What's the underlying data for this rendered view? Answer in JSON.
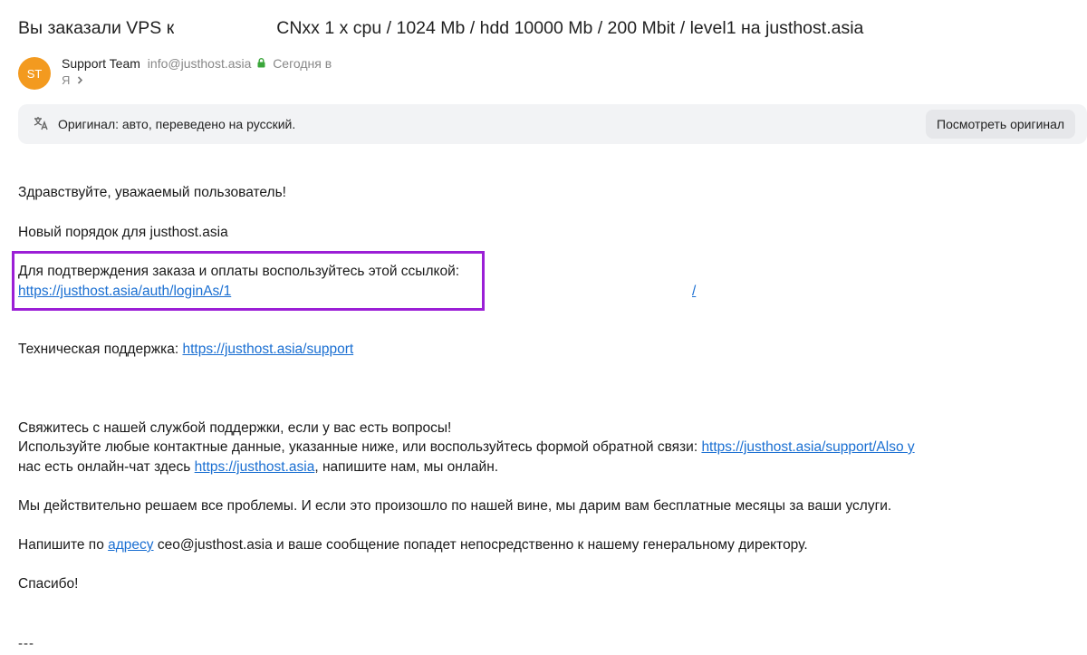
{
  "subject": {
    "start": "Вы заказали VPS к",
    "end": "CNxx 1 x cpu / 1024 Mb / hdd 10000 Mb / 200 Mbit / level1 на justhost.asia"
  },
  "sender": {
    "avatar_initials": "ST",
    "name": "Support Team",
    "email": "info@justhost.asia",
    "date": "Сегодня в",
    "recipient": "Я"
  },
  "translate_bar": {
    "text": "Оригинал: авто, переведено на русский.",
    "button_label": "Посмотреть оригинал"
  },
  "body": {
    "greeting": "Здравствуйте, уважаемый пользователь!",
    "new_order": "Новый порядок для justhost.asia",
    "confirm_text": "Для подтверждения заказа и оплаты воспользуйтесь этой ссылкой:",
    "confirm_link": "https://justhost.asia/auth/loginAs/1",
    "confirm_link_tail": "/",
    "support_label": "Техническая поддержка:",
    "support_link": "https://justhost.asia/support",
    "contact_line1": "Свяжитесь с нашей службой поддержки, если у вас есть вопросы!",
    "contact_line2_text": "Используйте любые контактные данные, указанные ниже, или воспользуйтесь формой обратной связи:",
    "contact_line2_link": "https://justhost.asia/support/Also у",
    "contact_line3_text": "нас есть онлайн-чат здесь",
    "contact_line3_link": "https://justhost.asia",
    "contact_line3_rest": ", напишите нам, мы онлайн.",
    "problems": "Мы действительно решаем все проблемы. И если это произошло по нашей вине, мы дарим вам бесплатные месяцы за ваши услуги.",
    "write_prefix": "Напишите по",
    "write_link": "адресу",
    "write_rest": "ceo@justhost.asia и ваше сообщение попадет непосредственно к нашему генеральному директору.",
    "thanks": "Спасибо!",
    "signature_sep": "---"
  },
  "colors": {
    "link": "#1a6fd2",
    "highlight_border": "#9b1fd6",
    "avatar": "#f39a1f",
    "lock": "#3aa63a"
  }
}
